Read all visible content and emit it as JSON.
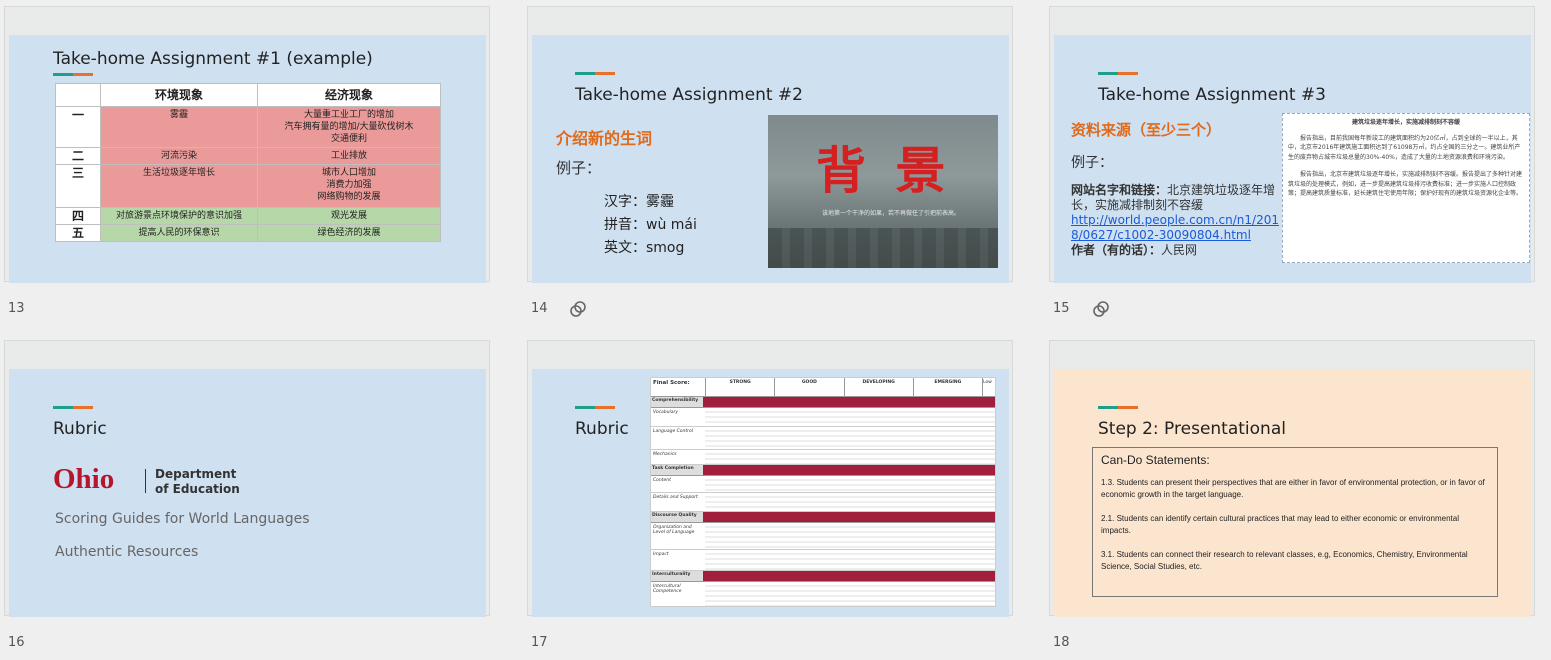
{
  "slides": {
    "s13": {
      "number": "13",
      "title": "Take-home Assignment #1 (example)",
      "table": {
        "headers": [
          "",
          "环境现象",
          "经济现象"
        ],
        "rows": [
          {
            "h": "一",
            "env": "雾霾",
            "econ": "大量重工业工厂的增加\n汽车拥有量的增加/大量砍伐树木\n交通便利"
          },
          {
            "h": "二",
            "env": "河流污染",
            "econ": "工业排放"
          },
          {
            "h": "三",
            "env": "生活垃圾逐年增长",
            "econ": "城市人口增加\n消费力加强\n网络购物的发展"
          },
          {
            "h": "四",
            "env": "对旅游景点环境保护的意识加强",
            "econ": "观光发展"
          },
          {
            "h": "五",
            "env": "提高人民的环保意识",
            "econ": "绿色经济的发展"
          }
        ]
      }
    },
    "s14": {
      "number": "14",
      "title": "Take-home Assignment #2",
      "subtitle": "介绍新的生词",
      "example_label": "例子：",
      "lines": [
        "汉字：雾霾",
        "拼音：wù mái",
        "英文：smog"
      ],
      "image_big_text": "背 景",
      "image_caption": "该地第一个干净的如果，若不再做任了引把前表高。"
    },
    "s15": {
      "number": "15",
      "title": "Take-home Assignment #3",
      "subtitle": "资料来源（至少三个）",
      "example_label": "例子：",
      "site_label": "网站名字和链接：",
      "site_text": "北京建筑垃圾逐年增长，实施减排制刻不容缓",
      "url": "http://world.people.com.cn/n1/2018/0627/c1002-30090804.html",
      "author_label": "作者（有的话）：",
      "author": "人民网",
      "article_title": "建筑垃圾逐年增长，实施减排制刻不容缓",
      "article_p1": "报告指出，目前我国每年新竣工的建筑面积约为20亿㎡，占到全球的一半以上，其中，北京市2016年建筑施工面积达到了61098万㎡，约占全国的三分之一。建筑业所产生的废弃物占城市垃圾总量的30%-40%，造成了大量的土地资源浪费和环境污染。",
      "article_p2": "报告指出，北京市建筑垃圾逐年增长，实施减排制刻不容缓。报告提出了多种针对建筑垃圾的处理模式，例如，进一步提高建筑垃圾排污收费标准；进一步实施人口控制政策；提高建筑质量标准，延长建筑住宅使用年限；保护好现有的建筑垃圾资源化企业等。"
    },
    "s16": {
      "number": "16",
      "title": "Rubric",
      "logo_ohio": "Ohio",
      "logo_dept1": "Department",
      "logo_dept2": "of Education",
      "link1": "Scoring Guides for World Languages",
      "link2": "Authentic Resources"
    },
    "s17": {
      "number": "17",
      "title": "Rubric",
      "rubric": {
        "final_score": "Final Score:",
        "cols": [
          "STRONG",
          "GOOD",
          "DEVELOPING",
          "EMERGING"
        ],
        "low": "Low",
        "sections": [
          "Comprehensibility",
          "Task Completion",
          "Discourse Quality",
          "Interculturality"
        ],
        "rows": [
          "Vocabulary",
          "Language Control",
          "Mechanics",
          "Content",
          "Details and Support",
          "Organization and Level of Language",
          "Impact",
          "Intercultural Competence"
        ]
      }
    },
    "s18": {
      "number": "18",
      "title": "Step 2: Presentational",
      "box_heading": "Can-Do Statements:",
      "statements": [
        "1.3. Students can present their perspectives that are either in favor of environmental protection, or in favor of economic  growth in the target language.",
        "2.1. Students can identify certain cultural practices that may lead to either economic or environmental impacts.",
        "3.1. Students can connect their research to relevant classes, e.g, Economics, Chemistry, Environmental Science, Social Studies, etc."
      ]
    }
  },
  "colors": {
    "accent_teal": "#1f9e8a",
    "accent_orange": "#e06a1a",
    "slide_blue": "#cfe0f1",
    "slide_peach": "#fbe5cf",
    "ohio_red": "#b5162b"
  }
}
